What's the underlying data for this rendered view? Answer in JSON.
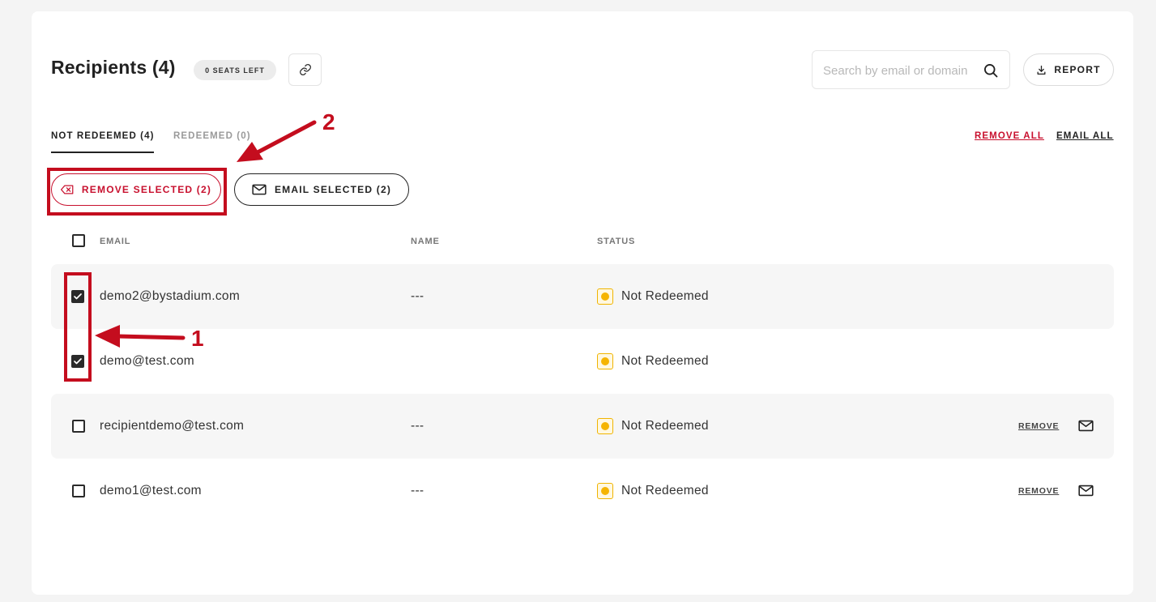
{
  "header": {
    "title": "Recipients (4)",
    "seats_badge": "0 SEATS LEFT",
    "link_icon": "link-icon",
    "search_placeholder": "Search by email or domain",
    "report_label": "REPORT"
  },
  "tabs": [
    {
      "label": "NOT REDEEMED (4)",
      "active": true
    },
    {
      "label": "REDEEMED (0)",
      "active": false
    }
  ],
  "bulk_links": {
    "remove_all": "REMOVE ALL",
    "email_all": "EMAIL ALL"
  },
  "bulk_buttons": {
    "remove_selected": "REMOVE SELECTED (2)",
    "email_selected": "EMAIL SELECTED (2)"
  },
  "columns": {
    "email": "EMAIL",
    "name": "NAME",
    "status": "STATUS"
  },
  "rows": [
    {
      "email": "demo2@bystadium.com",
      "name": "---",
      "status": "Not Redeemed",
      "checked": true,
      "remove_label": "",
      "show_actions": false
    },
    {
      "email": "demo@test.com",
      "name": "",
      "status": "Not Redeemed",
      "checked": true,
      "remove_label": "",
      "show_actions": false
    },
    {
      "email": "recipientdemo@test.com",
      "name": "---",
      "status": "Not Redeemed",
      "checked": false,
      "remove_label": "REMOVE",
      "show_actions": true
    },
    {
      "email": "demo1@test.com",
      "name": "---",
      "status": "Not Redeemed",
      "checked": false,
      "remove_label": "REMOVE",
      "show_actions": true
    }
  ],
  "annotations": {
    "marker_1": "1",
    "marker_2": "2"
  },
  "colors": {
    "accent_red": "#c8102e",
    "status_yellow": "#f5b400",
    "annotation_red": "#c40d1e"
  }
}
